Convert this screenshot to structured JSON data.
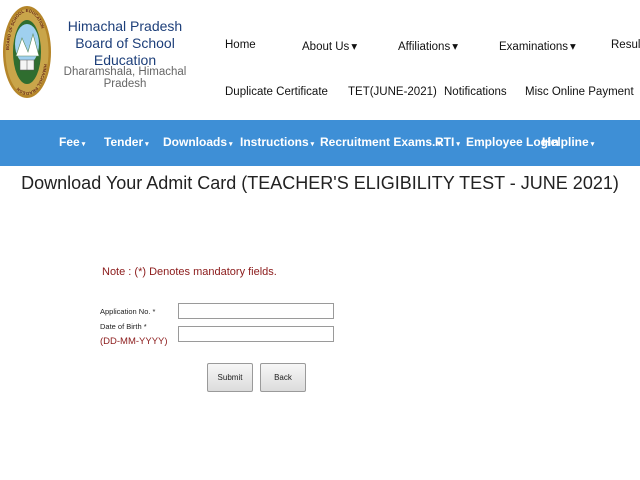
{
  "org": {
    "name_line1": "Himachal Pradesh",
    "name_line2": "Board of School Education",
    "location": "Dharamshala, Himachal Pradesh",
    "logo_ring_text": "BOARD OF SCHOOL EDUCATION",
    "logo_ring_text_bottom": "HIMACHAL PRADESH"
  },
  "top_nav": {
    "row1": [
      {
        "label": "Home",
        "caret": ""
      },
      {
        "label": "About Us",
        "caret": "▾"
      },
      {
        "label": "Affiliations",
        "caret": "▾"
      },
      {
        "label": "Examinations",
        "caret": "▾"
      },
      {
        "label": "Results",
        "caret": ""
      }
    ],
    "row2": [
      {
        "label": "Duplicate Certificate"
      },
      {
        "label": "TET(JUNE-2021)"
      },
      {
        "label": "Notifications"
      },
      {
        "label": "Misc Online Payment"
      }
    ]
  },
  "main_menu": [
    {
      "label": "Fee",
      "caret": "▾"
    },
    {
      "label": "Tender",
      "caret": "▾"
    },
    {
      "label": "Downloads",
      "caret": "▾"
    },
    {
      "label": "Instructions",
      "caret": "▾"
    },
    {
      "label": "Recruitment Exams.",
      "caret": "▾"
    },
    {
      "label": "RTI",
      "caret": "▾"
    },
    {
      "label": "Employee Login",
      "caret": ""
    },
    {
      "label": "Helpline",
      "caret": "▾"
    }
  ],
  "page": {
    "title": "Download Your Admit Card (TEACHER'S ELIGIBILITY TEST - JUNE 2021)",
    "note": "Note  : (*) Denotes mandatory fields."
  },
  "form": {
    "application_label": "Application No. *",
    "application_value": "",
    "dob_label": "Date of Birth *",
    "dob_format": "(DD-MM-YYYY)",
    "dob_value": "",
    "submit_label": "Submit",
    "back_label": "Back"
  },
  "colors": {
    "menu_bar": "#3e8fd6",
    "org_name": "#1d3f7a",
    "note_text": "#8b1a1a",
    "active_link": "#1e5ea8"
  }
}
